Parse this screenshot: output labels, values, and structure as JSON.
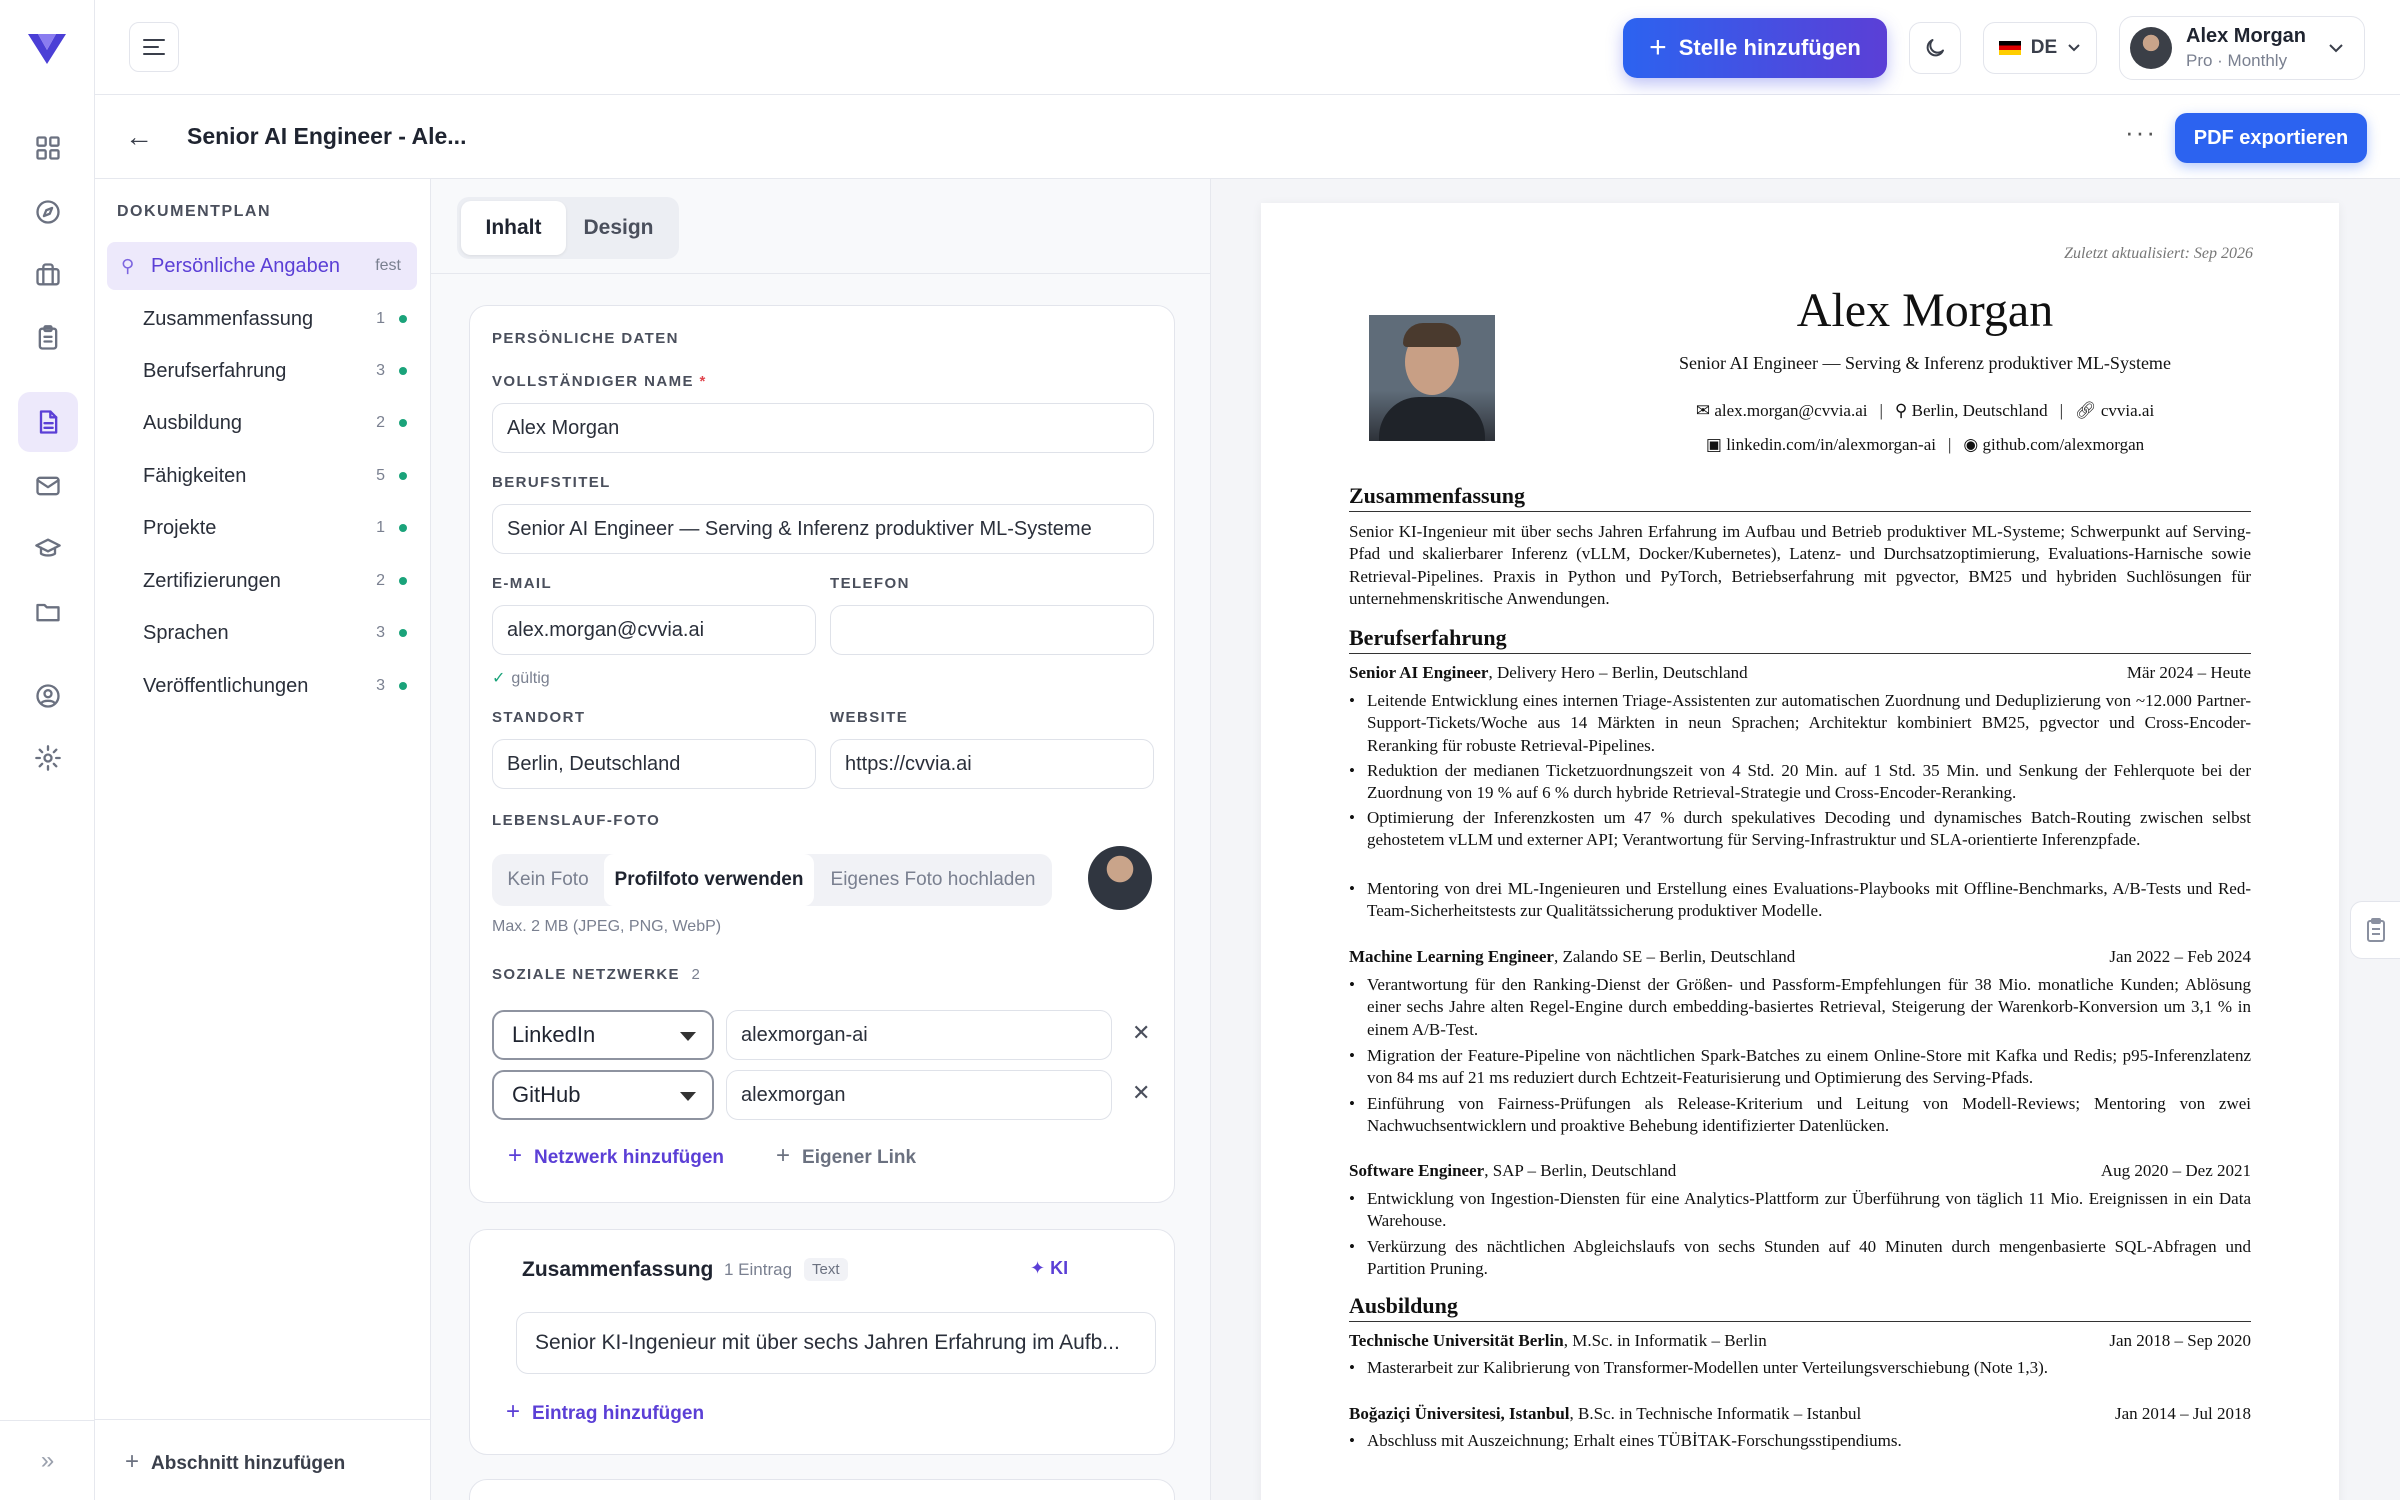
{
  "rail": {
    "items": [
      {
        "name": "dashboard-icon"
      },
      {
        "name": "compass-icon"
      },
      {
        "name": "briefcase-icon"
      },
      {
        "name": "clipboard-icon"
      },
      {
        "name": "document-icon"
      },
      {
        "name": "mail-icon"
      },
      {
        "name": "graduation-cap-icon"
      },
      {
        "name": "folder-icon"
      },
      {
        "name": "user-circle-icon"
      },
      {
        "name": "gear-icon"
      }
    ],
    "collapse_label": "»"
  },
  "topbar": {
    "add_job_label": "Stelle hinzufügen",
    "language": "DE",
    "user_name": "Alex Morgan",
    "user_plan": "Pro · Monthly"
  },
  "subbar": {
    "title": "Senior AI Engineer - Ale...",
    "more_label": "···",
    "export_label": "PDF exportieren"
  },
  "plan": {
    "heading": "DOKUMENTPLAN",
    "active": {
      "label": "Persönliche Angaben",
      "tag": "fest"
    },
    "items": [
      {
        "label": "Zusammenfassung",
        "count": "1"
      },
      {
        "label": "Berufserfahrung",
        "count": "3"
      },
      {
        "label": "Ausbildung",
        "count": "2"
      },
      {
        "label": "Fähigkeiten",
        "count": "5"
      },
      {
        "label": "Projekte",
        "count": "1"
      },
      {
        "label": "Zertifizierungen",
        "count": "2"
      },
      {
        "label": "Sprachen",
        "count": "3"
      },
      {
        "label": "Veröffentlichungen",
        "count": "3"
      }
    ],
    "add_section_label": "Abschnitt hinzufügen"
  },
  "editor": {
    "tabs": [
      "Inhalt",
      "Design"
    ],
    "personal": {
      "heading": "PERSÖNLICHE DATEN",
      "name_label": "VOLLSTÄNDIGER NAME",
      "name_value": "Alex Morgan",
      "title_label": "BERUFSTITEL",
      "title_value": "Senior AI Engineer — Serving & Inferenz produktiver ML-Systeme",
      "email_label": "E-MAIL",
      "email_value": "alex.morgan@cvvia.ai",
      "email_valid": "gültig",
      "phone_label": "TELEFON",
      "phone_value": "",
      "location_label": "STANDORT",
      "location_value": "Berlin, Deutschland",
      "website_label": "WEBSITE",
      "website_value": "https://cvvia.ai",
      "photo_label": "LEBENSLAUF-FOTO",
      "photo_options": [
        "Kein Foto",
        "Profilfoto verwenden",
        "Eigenes Foto hochladen"
      ],
      "photo_selected": "Profilfoto verwenden",
      "photo_hint": "Max. 2 MB (JPEG, PNG, WebP)",
      "social_label": "SOZIALE NETZWERKE",
      "social_count": "2",
      "socials": [
        {
          "network": "LinkedIn",
          "handle": "alexmorgan-ai"
        },
        {
          "network": "GitHub",
          "handle": "alexmorgan"
        }
      ],
      "add_network_label": "Netzwerk hinzufügen",
      "custom_link_label": "Eigener Link"
    },
    "summary": {
      "title": "Zusammenfassung",
      "count": "1 Eintrag",
      "tag": "Text",
      "ai_label": "KI",
      "entry": "Senior KI-Ingenieur mit über sechs Jahren Erfahrung im Aufb...",
      "add_entry_label": "Eintrag hinzufügen"
    }
  },
  "cv": {
    "updated": "Zuletzt aktualisiert: Sep 2026",
    "name": "Alex Morgan",
    "role": "Senior AI Engineer — Serving & Inferenz produktiver ML-Systeme",
    "email": "alex.morgan@cvvia.ai",
    "location": "Berlin, Deutschland",
    "website": "cvvia.ai",
    "linkedin": "linkedin.com/in/alexmorgan-ai",
    "github": "github.com/alexmorgan",
    "summary_heading": "Zusammenfassung",
    "summary_text": "Senior KI-Ingenieur mit über sechs Jahren Erfahrung im Aufbau und Betrieb produktiver ML-Systeme; Schwerpunkt auf Serving-Pfad und skalierbarer Inferenz (vLLM, Docker/Kubernetes), Latenz- und Durchsatzoptimierung, Evaluations-Harnische sowie Retrieval-Pipelines. Praxis in Python und PyTorch, Betriebserfahrung mit pgvector, BM25 und hybriden Suchlösungen für unternehmenskritische Anwendungen.",
    "experience_heading": "Berufserfahrung",
    "jobs": [
      {
        "title": "Senior AI Engineer",
        "company": ", Delivery Hero – Berlin, Deutschland",
        "dates": "Mär 2024 – Heute",
        "bullets": [
          "Leitende Entwicklung eines internen Triage-Assistenten zur automatischen Zuordnung und Deduplizierung von ~12.000 Partner-Support-Tickets/Woche aus 14 Märkten in neun Sprachen; Architektur kombiniert BM25, pgvector und Cross-Encoder-Reranking für robuste Retrieval-Pipelines.",
          "Reduktion der medianen Ticketzuordnungszeit von 4 Std. 20 Min. auf 1 Std. 35 Min. und Senkung der Fehlerquote bei der Zuordnung von 19 % auf 6 % durch hybride Retrieval-Strategie und Cross-Encoder-Reranking.",
          "Optimierung der Inferenzkosten um 47 % durch spekulatives Decoding und dynamisches Batch-Routing zwischen selbst gehostetem vLLM und externer API; Verantwortung für Serving-Infrastruktur und SLA-orientierte Inferenzpfade.",
          "Mentoring von drei ML-Ingenieuren und Erstellung eines Evaluations-Playbooks mit Offline-Benchmarks, A/B-Tests und Red-Team-Sicherheitstests zur Qualitätssicherung produktiver Modelle."
        ]
      },
      {
        "title": "Machine Learning Engineer",
        "company": ", Zalando SE – Berlin, Deutschland",
        "dates": "Jan 2022 – Feb 2024",
        "bullets": [
          "Verantwortung für den Ranking-Dienst der Größen- und Passform-Empfehlungen für 38 Mio. monatliche Kunden; Ablösung einer sechs Jahre alten Regel-Engine durch embedding-basiertes Retrieval, Steigerung der Warenkorb-Konversion um 3,1 % in einem A/B-Test.",
          "Migration der Feature-Pipeline von nächtlichen Spark-Batches zu einem Online-Store mit Kafka und Redis; p95-Inferenzlatenz von 84 ms auf 21 ms reduziert durch Echtzeit-Featurisierung und Optimierung des Serving-Pfads.",
          "Einführung von Fairness-Prüfungen als Release-Kriterium und Leitung von Modell-Reviews; Mentoring von zwei Nachwuchsentwicklern und proaktive Behebung identifizierter Datenlücken."
        ]
      },
      {
        "title": "Software Engineer",
        "company": ", SAP – Berlin, Deutschland",
        "dates": "Aug 2020 – Dez 2021",
        "bullets": [
          "Entwicklung von Ingestion-Diensten für eine Analytics-Plattform zur Überführung von täglich 11 Mio. Ereignissen in ein Data Warehouse.",
          "Verkürzung des nächtlichen Abgleichslaufs von sechs Stunden auf 40 Minuten durch mengenbasierte SQL-Abfragen und Partition Pruning."
        ]
      }
    ],
    "education_heading": "Ausbildung",
    "education": [
      {
        "school": "Technische Universität Berlin",
        "degree": ", M.Sc. in Informatik – Berlin",
        "dates": "Jan 2018 – Sep 2020",
        "bullet": "Masterarbeit zur Kalibrierung von Transformer-Modellen unter Verteilungsverschiebung (Note 1,3)."
      },
      {
        "school": "Boğaziçi Üniversitesi, Istanbul",
        "degree": ", B.Sc. in Technische Informatik – Istanbul",
        "dates": "Jan 2014 – Jul 2018",
        "bullet": "Abschluss mit Auszeichnung; Erhalt eines TÜBİTAK-Forschungsstipendiums."
      }
    ]
  }
}
